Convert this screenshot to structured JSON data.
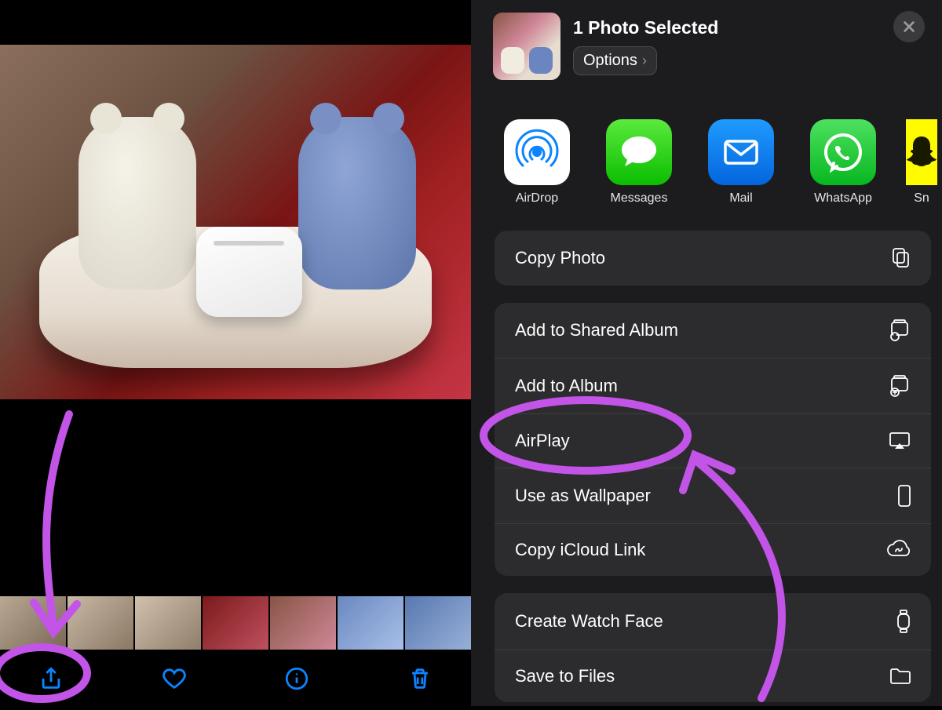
{
  "share_sheet": {
    "title": "1 Photo Selected",
    "options_label": "Options",
    "apps": [
      {
        "name": "AirDrop"
      },
      {
        "name": "Messages"
      },
      {
        "name": "Mail"
      },
      {
        "name": "WhatsApp"
      },
      {
        "name": "Sn"
      }
    ],
    "group1": [
      {
        "label": "Copy Photo",
        "icon": "copy"
      }
    ],
    "group2": [
      {
        "label": "Add to Shared Album",
        "icon": "shared-album"
      },
      {
        "label": "Add to Album",
        "icon": "album"
      },
      {
        "label": "AirPlay",
        "icon": "airplay"
      },
      {
        "label": "Use as Wallpaper",
        "icon": "phone"
      },
      {
        "label": "Copy iCloud Link",
        "icon": "cloud-link"
      }
    ],
    "group3": [
      {
        "label": "Create Watch Face",
        "icon": "watch"
      },
      {
        "label": "Save to Files",
        "icon": "folder"
      }
    ]
  },
  "annotation": {
    "highlight_action": "AirPlay",
    "highlight_toolbar": "share-button"
  }
}
